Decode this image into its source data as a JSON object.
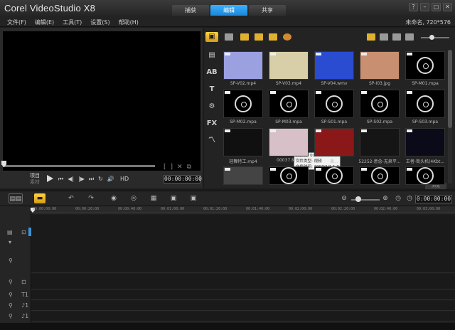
{
  "app": {
    "title": "Corel VideoStudio X8",
    "mode_tabs": [
      {
        "label": "捕获",
        "active": false
      },
      {
        "label": "编辑",
        "active": true
      },
      {
        "label": "共享",
        "active": false
      }
    ],
    "window_buttons": [
      "?",
      "–",
      "□",
      "✕"
    ]
  },
  "menu": {
    "items": [
      "文件(F)",
      "编辑(E)",
      "工具(T)",
      "设置(S)",
      "帮助(H)"
    ],
    "project_info": "未命名, 720*576"
  },
  "preview": {
    "mode_project": "项目",
    "mode_clip": "素材",
    "controls": [
      "▶",
      "⏮",
      "◀|",
      "|▶",
      "⏭",
      "↻",
      "🔊"
    ],
    "hd": "HD",
    "timecode": "00:00:00:00",
    "trim_icons": [
      "[",
      "]",
      "✕",
      "⧉"
    ]
  },
  "library": {
    "side_tools": [
      "▣",
      "▤",
      "AB",
      "T",
      "⚙",
      "FX",
      "〽"
    ],
    "toolbar_icons": [
      "folder-icon",
      "video-filter-icon",
      "photo-filter-icon",
      "music-filter-icon",
      "effect-filter-icon"
    ],
    "clips": [
      {
        "label": "SP-V02.mp4",
        "kind": "video",
        "color": "#9aa0e0"
      },
      {
        "label": "SP-V03.mp4",
        "kind": "video",
        "color": "#d8cfa8"
      },
      {
        "label": "SP-V04.wmv",
        "kind": "video",
        "color": "#2a4cd0"
      },
      {
        "label": "SP-I03.jpg",
        "kind": "image",
        "color": "#c89070"
      },
      {
        "label": "SP-M01.mpa",
        "kind": "audio",
        "color": "#000000"
      },
      {
        "label": "SP-M02.mpa",
        "kind": "audio",
        "color": "#000000"
      },
      {
        "label": "SP-M03.mpa",
        "kind": "audio",
        "color": "#000000"
      },
      {
        "label": "SP-S01.mpa",
        "kind": "audio",
        "color": "#000000"
      },
      {
        "label": "SP-S02.mpa",
        "kind": "audio",
        "color": "#000000"
      },
      {
        "label": "SP-S03.mpa",
        "kind": "audio",
        "color": "#000000"
      },
      {
        "label": "轻舞特工.mp4",
        "kind": "video",
        "color": "#101010"
      },
      {
        "label": "00037.MTS",
        "kind": "video",
        "color": "#d8c0c8"
      },
      {
        "label": "表...",
        "kind": "video",
        "color": "#8a1818"
      },
      {
        "label": "52252-意念-无泉平...",
        "kind": "video",
        "color": "#151515"
      },
      {
        "label": "王者-街头机(4Kbt...",
        "kind": "video",
        "color": "#0a0a18"
      },
      {
        "label": "",
        "kind": "video",
        "color": "#444444"
      },
      {
        "label": "",
        "kind": "audio",
        "color": "#000000"
      },
      {
        "label": "",
        "kind": "audio",
        "color": "#000000"
      },
      {
        "label": "",
        "kind": "audio",
        "color": "#000000"
      },
      {
        "label": "",
        "kind": "audio",
        "color": "#000000"
      }
    ],
    "tooltip": {
      "line1": "文件名: 00037.MTS",
      "line2": "文件类型: 视频",
      "line3": "文件时间: 2007/1/1 1:0:16"
    },
    "browse": "浏览"
  },
  "timeline": {
    "toolbar_icons": [
      "▤▤",
      "▬",
      "↶",
      "↷",
      "◉",
      "◎",
      "▦",
      "▣"
    ],
    "zoom": [
      "⊖",
      "⊕",
      "◷"
    ],
    "timecode": "0:00:00:00",
    "ruler": [
      "00:00:00:00",
      "00:00:20:00",
      "00:00:40:00",
      "00:01:00:00",
      "00:01:20:00",
      "00:01:40:00",
      "00:02:00:00",
      "00:02:20:00",
      "00:02:40:00",
      "00:03:00:00"
    ],
    "track_icons": [
      "▤",
      "⊡",
      "T1",
      "T1",
      "♪1",
      "♪1"
    ]
  },
  "colors": {
    "accent_blue": "#1e86d6",
    "accent_yellow": "#d79b16"
  }
}
